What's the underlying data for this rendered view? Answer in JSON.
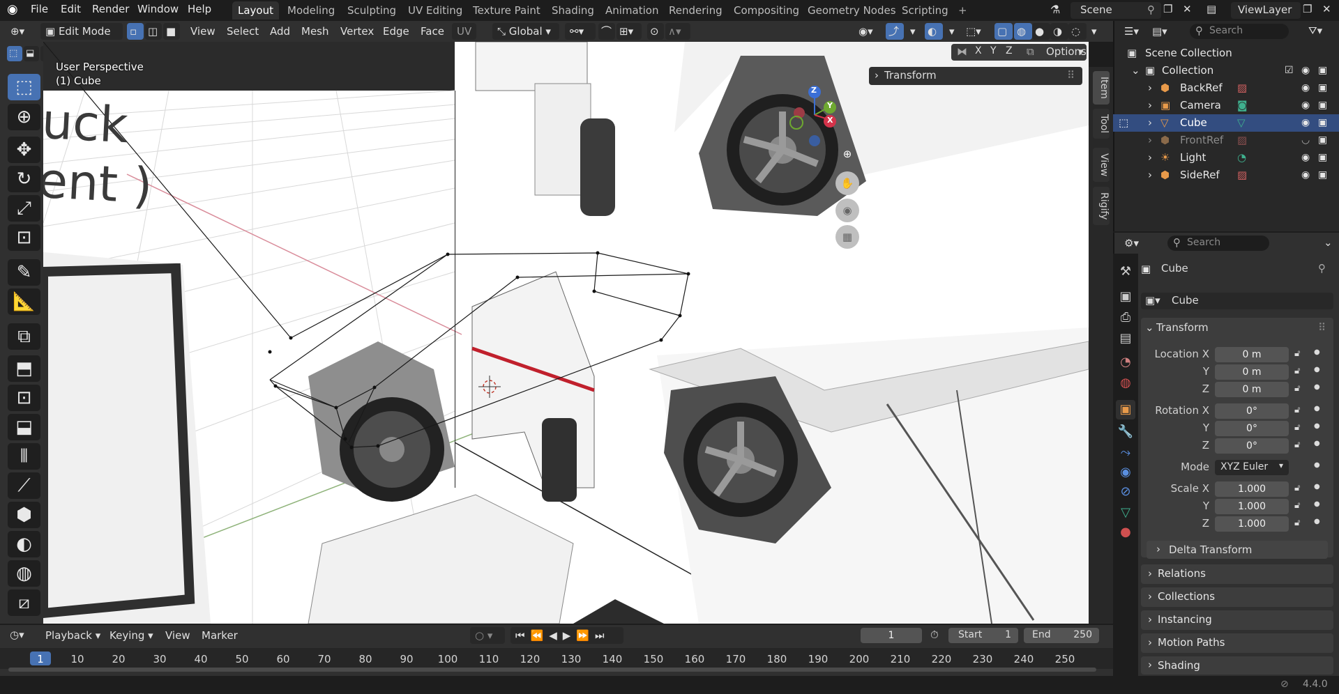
{
  "menubar": {
    "items": [
      "File",
      "Edit",
      "Render",
      "Window",
      "Help"
    ],
    "workspaces": [
      "Layout",
      "Modeling",
      "Sculpting",
      "UV Editing",
      "Texture Paint",
      "Shading",
      "Animation",
      "Rendering",
      "Compositing",
      "Geometry Nodes",
      "Scripting"
    ],
    "add_tab": "+",
    "scene": "Scene",
    "view_layer": "ViewLayer"
  },
  "viewport_header": {
    "mode": "Edit Mode",
    "menus": [
      "View",
      "Select",
      "Add",
      "Mesh",
      "Vertex",
      "Edge",
      "Face",
      "UV"
    ],
    "orientation": "Global",
    "options": "Options",
    "axes": [
      "X",
      "Y",
      "Z"
    ]
  },
  "viewport": {
    "perspective": "User Perspective",
    "object": "(1) Cube",
    "bg_text_1": "uck",
    "bg_text_2": "ent )",
    "transform_panel": "Transform",
    "gizmo": {
      "x": "X",
      "y": "Y",
      "z": "Z"
    }
  },
  "sidebar_tabs": [
    "Item",
    "Tool",
    "View",
    "Rigify"
  ],
  "outliner": {
    "search_placeholder": "Search",
    "scene_collection": "Scene Collection",
    "collection": "Collection",
    "items": [
      {
        "name": "BackRef",
        "icon": "image-empty-icon",
        "selected": false,
        "dim": false
      },
      {
        "name": "Camera",
        "icon": "camera-icon",
        "selected": false,
        "dim": false
      },
      {
        "name": "Cube",
        "icon": "mesh-icon",
        "selected": true,
        "dim": false
      },
      {
        "name": "FrontRef",
        "icon": "image-empty-icon",
        "selected": false,
        "dim": true
      },
      {
        "name": "Light",
        "icon": "light-icon",
        "selected": false,
        "dim": false
      },
      {
        "name": "SideRef",
        "icon": "image-empty-icon",
        "selected": false,
        "dim": false
      }
    ]
  },
  "properties": {
    "search_placeholder": "Search",
    "object_name": "Cube",
    "object_field": "Cube",
    "transform_title": "Transform",
    "location": {
      "label": "Location X",
      "x": "0 m",
      "y": "0 m",
      "z": "0 m"
    },
    "rotation": {
      "label": "Rotation X",
      "x": "0°",
      "y": "0°",
      "z": "0°"
    },
    "mode_label": "Mode",
    "mode_value": "XYZ Euler",
    "scale": {
      "label": "Scale X",
      "x": "1.000",
      "y": "1.000",
      "z": "1.000"
    },
    "axis_y": "Y",
    "axis_z": "Z",
    "delta": "Delta Transform",
    "panels": [
      "Relations",
      "Collections",
      "Instancing",
      "Motion Paths",
      "Shading"
    ]
  },
  "timeline": {
    "menus": [
      "Playback",
      "Keying",
      "View",
      "Marker"
    ],
    "current_frame": "1",
    "start_label": "Start",
    "start": "1",
    "end_label": "End",
    "end": "250",
    "ruler": [
      "1",
      "10",
      "20",
      "30",
      "40",
      "50",
      "60",
      "70",
      "80",
      "90",
      "100",
      "110",
      "120",
      "130",
      "140",
      "150",
      "160",
      "170",
      "180",
      "190",
      "200",
      "210",
      "220",
      "230",
      "240",
      "250"
    ]
  },
  "statusbar": {
    "version": "4.4.0"
  },
  "colors": {
    "accent": "#4772b3",
    "header": "#303030",
    "background": "#1d1d1d",
    "panel": "#282828"
  }
}
